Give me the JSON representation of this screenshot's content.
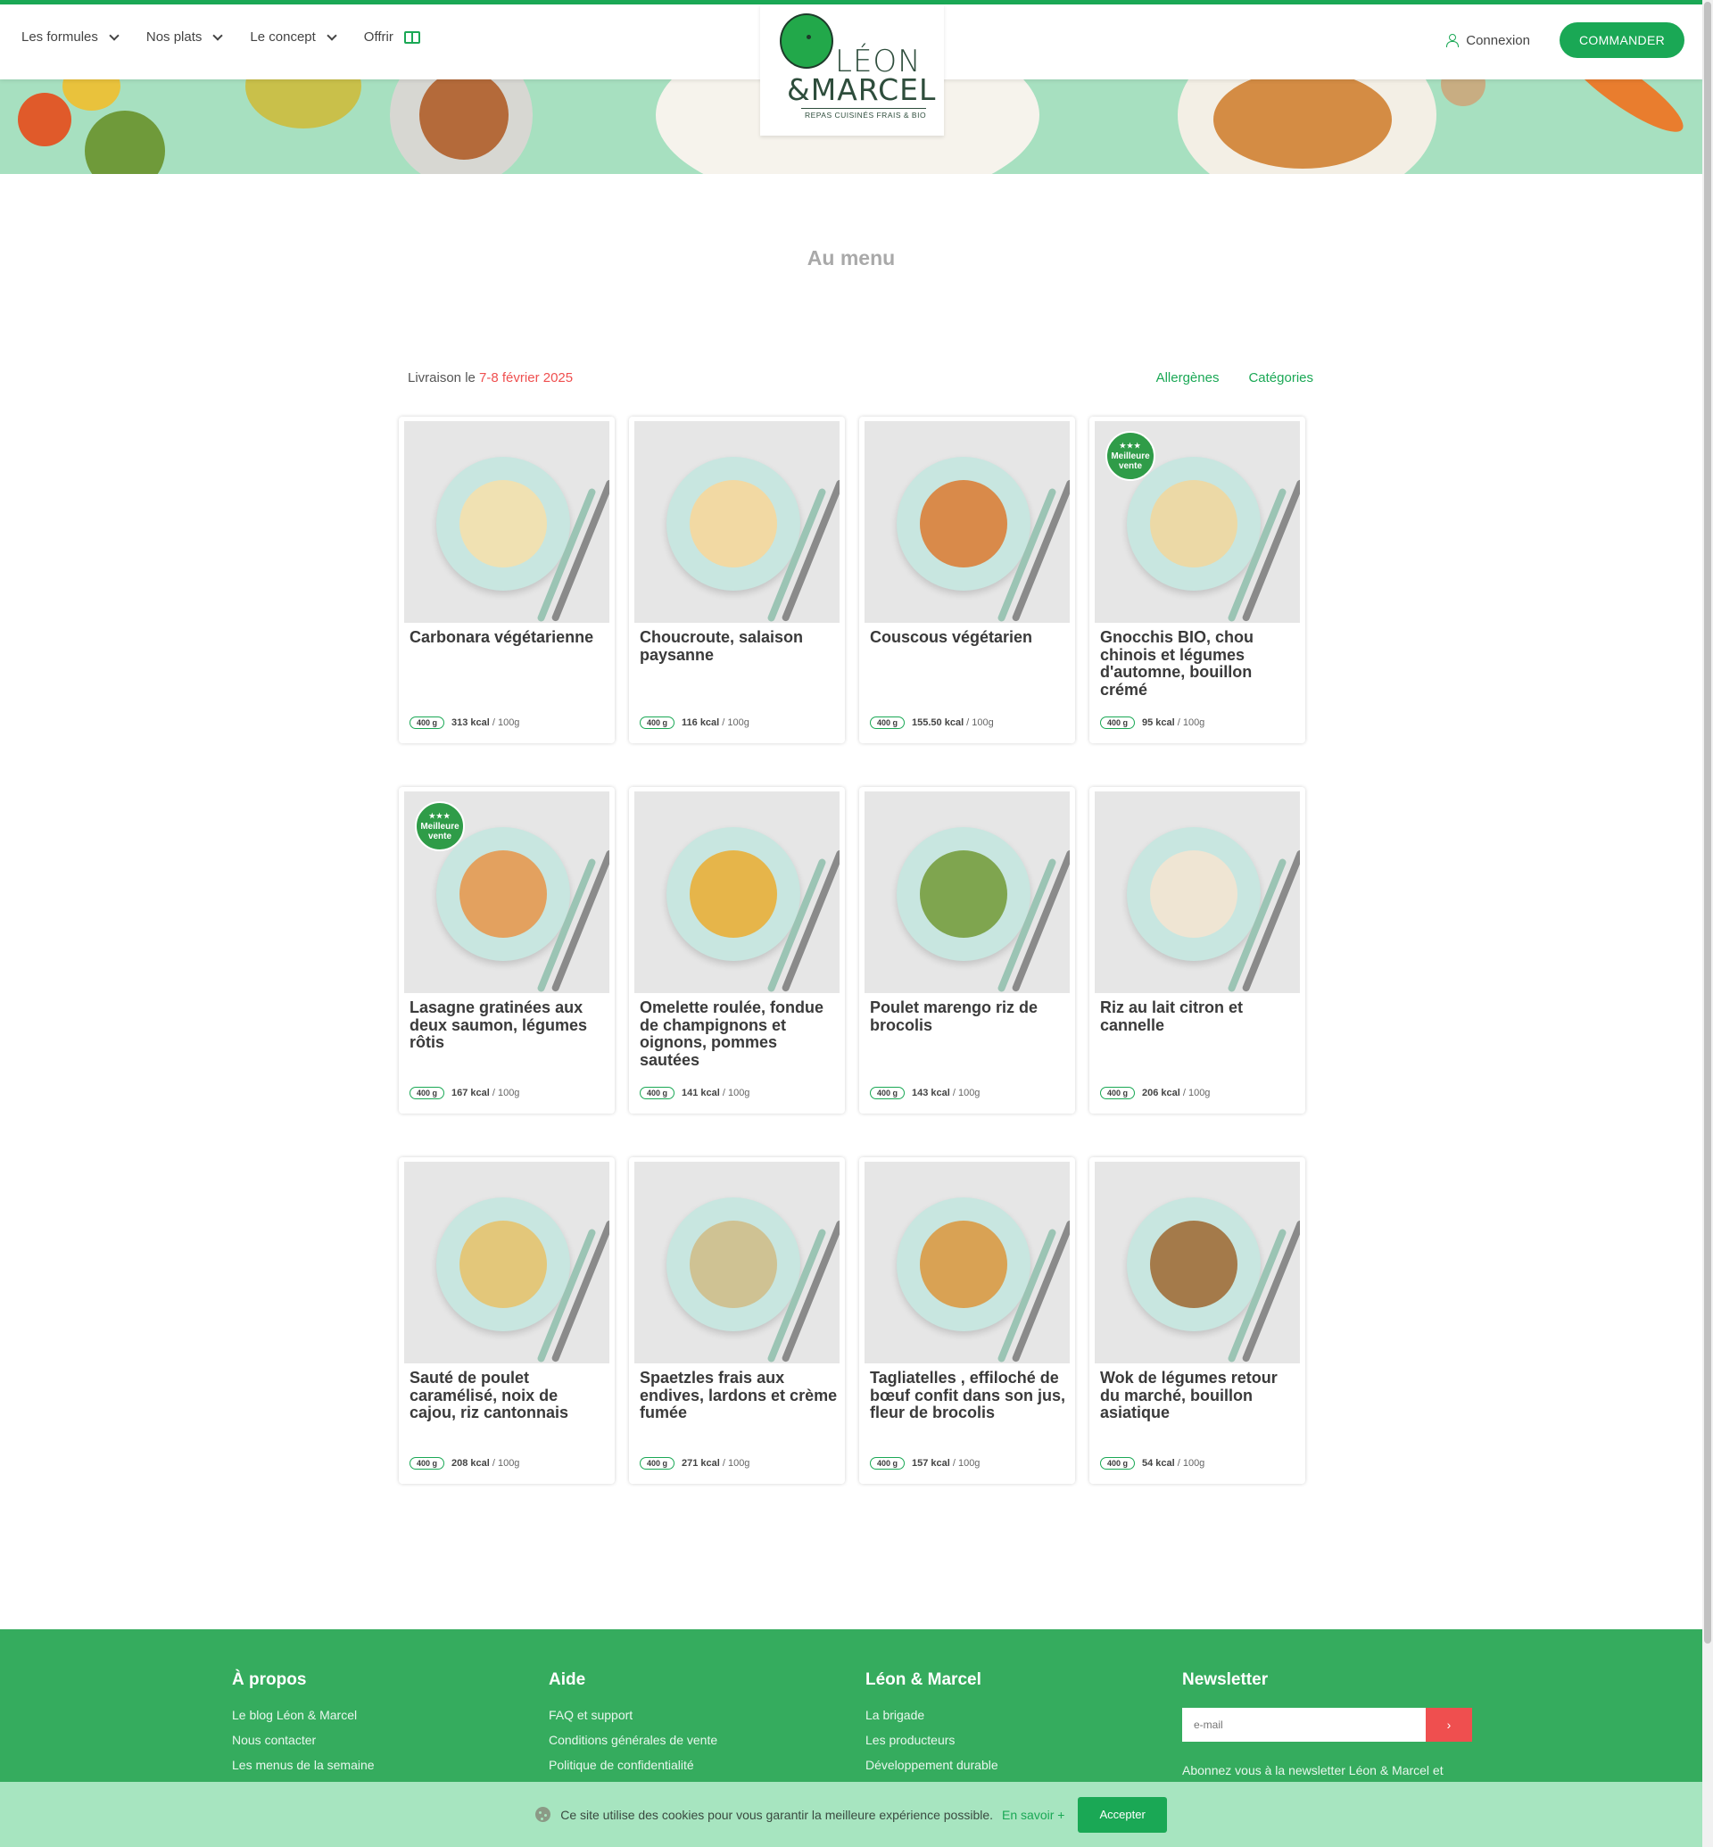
{
  "header": {
    "nav": [
      {
        "label": "Les formules",
        "has_dropdown": true
      },
      {
        "label": "Nos plats",
        "has_dropdown": true
      },
      {
        "label": "Le concept",
        "has_dropdown": true
      }
    ],
    "offer_label": "Offrir",
    "login_label": "Connexion",
    "order_label": "COMMANDER"
  },
  "logo": {
    "line1": "LÉON",
    "line2": "&MARCEL",
    "tagline": "REPAS CUISINÉS FRAIS & BIO"
  },
  "menu": {
    "title": "Au menu",
    "delivery_prefix": "Livraison le ",
    "delivery_date": "7-8 février 2025",
    "filters": [
      "Allergènes",
      "Catégories"
    ]
  },
  "badge": {
    "stars": "★★★",
    "line1": "Meilleure",
    "line2": "vente"
  },
  "dishes": [
    {
      "name": "Carbonara végétarienne",
      "weight": "400 g",
      "kcal": "313 kcal",
      "per": "/ 100g",
      "bestseller": false,
      "color": "#f0e1b2"
    },
    {
      "name": "Choucroute, salaison paysanne",
      "weight": "400 g",
      "kcal": "116 kcal",
      "per": "/ 100g",
      "bestseller": false,
      "color": "#f2d9a3"
    },
    {
      "name": "Couscous végétarien",
      "weight": "400 g",
      "kcal": "155.50 kcal",
      "per": "/ 100g",
      "bestseller": false,
      "color": "#d98a4a"
    },
    {
      "name": "Gnocchis BIO, chou chinois et légumes d'automne, bouillon crémé",
      "weight": "400 g",
      "kcal": "95 kcal",
      "per": "/ 100g",
      "bestseller": true,
      "color": "#ecd9a6"
    },
    {
      "name": "Lasagne gratinées aux deux saumon, légumes rôtis",
      "weight": "400 g",
      "kcal": "167 kcal",
      "per": "/ 100g",
      "bestseller": true,
      "color": "#e3a15f"
    },
    {
      "name": "Omelette roulée, fondue de champignons et oignons, pommes sautées",
      "weight": "400 g",
      "kcal": "141 kcal",
      "per": "/ 100g",
      "bestseller": false,
      "color": "#e6b54a"
    },
    {
      "name": "Poulet marengo riz de brocolis",
      "weight": "400 g",
      "kcal": "143 kcal",
      "per": "/ 100g",
      "bestseller": false,
      "color": "#7fa54f"
    },
    {
      "name": "Riz au lait citron et cannelle",
      "weight": "400 g",
      "kcal": "206 kcal",
      "per": "/ 100g",
      "bestseller": false,
      "color": "#efe5d3"
    },
    {
      "name": "Sauté de poulet caramélisé, noix de cajou, riz cantonnais",
      "weight": "400 g",
      "kcal": "208 kcal",
      "per": "/ 100g",
      "bestseller": false,
      "color": "#e3c77a"
    },
    {
      "name": "Spaetzles frais aux endives, lardons et crème fumée",
      "weight": "400 g",
      "kcal": "271 kcal",
      "per": "/ 100g",
      "bestseller": false,
      "color": "#cfc293"
    },
    {
      "name": "Tagliatelles , effiloché de bœuf confit dans son jus, fleur de brocolis",
      "weight": "400 g",
      "kcal": "157 kcal",
      "per": "/ 100g",
      "bestseller": false,
      "color": "#d9a254"
    },
    {
      "name": "Wok de légumes retour du marché, bouillon asiatique",
      "weight": "400 g",
      "kcal": "54 kcal",
      "per": "/ 100g",
      "bestseller": false,
      "color": "#a47a4a"
    }
  ],
  "footer": {
    "about": {
      "title": "À propos",
      "links": [
        "Le blog Léon & Marcel",
        "Nous contacter",
        "Les menus de la semaine"
      ]
    },
    "help": {
      "title": "Aide",
      "links": [
        "FAQ et support",
        "Conditions générales de vente",
        "Politique de confidentialité"
      ]
    },
    "brand": {
      "title": "Léon & Marcel",
      "links": [
        "La brigade",
        "Les producteurs",
        "Développement durable"
      ]
    },
    "newsletter": {
      "title": "Newsletter",
      "placeholder": "e-mail",
      "text": "Abonnez vous à la newsletter Léon & Marcel et"
    }
  },
  "cookie": {
    "text": "Ce site utilise des cookies pour vous garantir la meilleure expérience possible.",
    "more": "En savoir +",
    "accept": "Accepter"
  },
  "colors": {
    "brand_green": "#1aa855",
    "accent_red": "#ef4f4f",
    "hero_mint": "#a7e0c0",
    "footer_green": "#35ac5e"
  }
}
